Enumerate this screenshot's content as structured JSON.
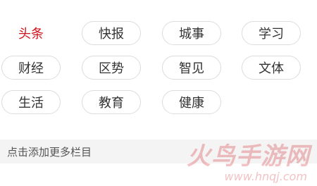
{
  "categories": [
    {
      "label": "头条",
      "active": true
    },
    {
      "label": "快报",
      "active": false
    },
    {
      "label": "城事",
      "active": false
    },
    {
      "label": "学习",
      "active": false
    },
    {
      "label": "财经",
      "active": false
    },
    {
      "label": "区势",
      "active": false
    },
    {
      "label": "智见",
      "active": false
    },
    {
      "label": "文体",
      "active": false
    },
    {
      "label": "生活",
      "active": false
    },
    {
      "label": "教育",
      "active": false
    },
    {
      "label": "健康",
      "active": false
    }
  ],
  "footer": {
    "label": "点击添加更多栏目"
  },
  "watermark": {
    "title": "火鸟手游网",
    "url": "www.hnqj.com"
  },
  "colors": {
    "active": "#d0111b",
    "text": "#333333",
    "border": "#dcdcdc",
    "footer_bg": "#f4f4f4"
  }
}
